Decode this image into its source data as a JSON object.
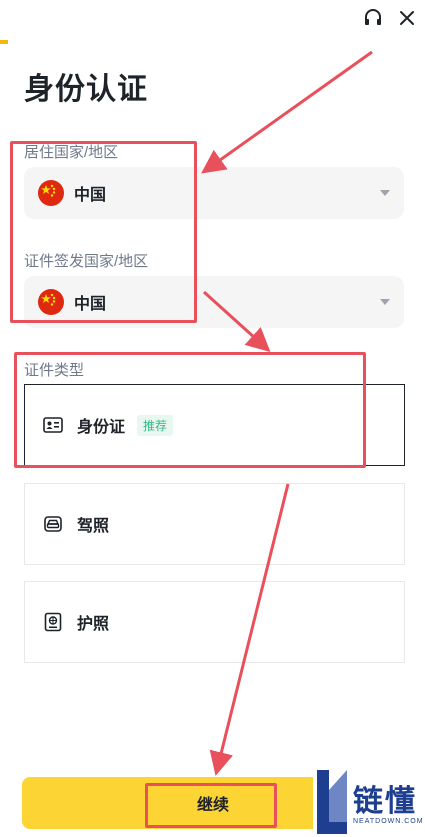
{
  "header": {
    "title": "身份认证",
    "support_icon": "headset-icon",
    "close_icon": "close-icon"
  },
  "residence": {
    "label": "居住国家/地区",
    "value": "中国",
    "flag": "china-flag-icon"
  },
  "issuing": {
    "label": "证件签发国家/地区",
    "value": "中国",
    "flag": "china-flag-icon"
  },
  "id_type": {
    "label": "证件类型",
    "options": [
      {
        "label": "身份证",
        "badge": "推荐",
        "icon": "id-card-icon",
        "selected": true
      },
      {
        "label": "驾照",
        "icon": "car-icon",
        "selected": false
      },
      {
        "label": "护照",
        "icon": "passport-icon",
        "selected": false
      }
    ]
  },
  "footer": {
    "continue_label": "继续"
  },
  "watermark": {
    "text": "链懂",
    "sub": "NEATDOWN.COM"
  },
  "colors": {
    "accent": "#fcd535",
    "annotation": "#e8505b",
    "badge_green": "#2ebd85"
  }
}
